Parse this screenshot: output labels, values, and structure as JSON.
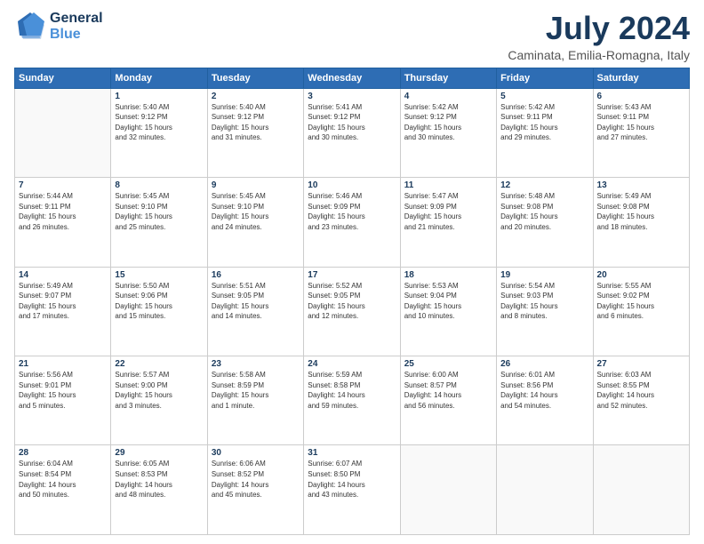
{
  "header": {
    "logo_general": "General",
    "logo_blue": "Blue",
    "title": "July 2024",
    "subtitle": "Caminata, Emilia-Romagna, Italy"
  },
  "days_of_week": [
    "Sunday",
    "Monday",
    "Tuesday",
    "Wednesday",
    "Thursday",
    "Friday",
    "Saturday"
  ],
  "weeks": [
    [
      {
        "day": "",
        "info": ""
      },
      {
        "day": "1",
        "info": "Sunrise: 5:40 AM\nSunset: 9:12 PM\nDaylight: 15 hours\nand 32 minutes."
      },
      {
        "day": "2",
        "info": "Sunrise: 5:40 AM\nSunset: 9:12 PM\nDaylight: 15 hours\nand 31 minutes."
      },
      {
        "day": "3",
        "info": "Sunrise: 5:41 AM\nSunset: 9:12 PM\nDaylight: 15 hours\nand 30 minutes."
      },
      {
        "day": "4",
        "info": "Sunrise: 5:42 AM\nSunset: 9:12 PM\nDaylight: 15 hours\nand 30 minutes."
      },
      {
        "day": "5",
        "info": "Sunrise: 5:42 AM\nSunset: 9:11 PM\nDaylight: 15 hours\nand 29 minutes."
      },
      {
        "day": "6",
        "info": "Sunrise: 5:43 AM\nSunset: 9:11 PM\nDaylight: 15 hours\nand 27 minutes."
      }
    ],
    [
      {
        "day": "7",
        "info": "Sunrise: 5:44 AM\nSunset: 9:11 PM\nDaylight: 15 hours\nand 26 minutes."
      },
      {
        "day": "8",
        "info": "Sunrise: 5:45 AM\nSunset: 9:10 PM\nDaylight: 15 hours\nand 25 minutes."
      },
      {
        "day": "9",
        "info": "Sunrise: 5:45 AM\nSunset: 9:10 PM\nDaylight: 15 hours\nand 24 minutes."
      },
      {
        "day": "10",
        "info": "Sunrise: 5:46 AM\nSunset: 9:09 PM\nDaylight: 15 hours\nand 23 minutes."
      },
      {
        "day": "11",
        "info": "Sunrise: 5:47 AM\nSunset: 9:09 PM\nDaylight: 15 hours\nand 21 minutes."
      },
      {
        "day": "12",
        "info": "Sunrise: 5:48 AM\nSunset: 9:08 PM\nDaylight: 15 hours\nand 20 minutes."
      },
      {
        "day": "13",
        "info": "Sunrise: 5:49 AM\nSunset: 9:08 PM\nDaylight: 15 hours\nand 18 minutes."
      }
    ],
    [
      {
        "day": "14",
        "info": "Sunrise: 5:49 AM\nSunset: 9:07 PM\nDaylight: 15 hours\nand 17 minutes."
      },
      {
        "day": "15",
        "info": "Sunrise: 5:50 AM\nSunset: 9:06 PM\nDaylight: 15 hours\nand 15 minutes."
      },
      {
        "day": "16",
        "info": "Sunrise: 5:51 AM\nSunset: 9:05 PM\nDaylight: 15 hours\nand 14 minutes."
      },
      {
        "day": "17",
        "info": "Sunrise: 5:52 AM\nSunset: 9:05 PM\nDaylight: 15 hours\nand 12 minutes."
      },
      {
        "day": "18",
        "info": "Sunrise: 5:53 AM\nSunset: 9:04 PM\nDaylight: 15 hours\nand 10 minutes."
      },
      {
        "day": "19",
        "info": "Sunrise: 5:54 AM\nSunset: 9:03 PM\nDaylight: 15 hours\nand 8 minutes."
      },
      {
        "day": "20",
        "info": "Sunrise: 5:55 AM\nSunset: 9:02 PM\nDaylight: 15 hours\nand 6 minutes."
      }
    ],
    [
      {
        "day": "21",
        "info": "Sunrise: 5:56 AM\nSunset: 9:01 PM\nDaylight: 15 hours\nand 5 minutes."
      },
      {
        "day": "22",
        "info": "Sunrise: 5:57 AM\nSunset: 9:00 PM\nDaylight: 15 hours\nand 3 minutes."
      },
      {
        "day": "23",
        "info": "Sunrise: 5:58 AM\nSunset: 8:59 PM\nDaylight: 15 hours\nand 1 minute."
      },
      {
        "day": "24",
        "info": "Sunrise: 5:59 AM\nSunset: 8:58 PM\nDaylight: 14 hours\nand 59 minutes."
      },
      {
        "day": "25",
        "info": "Sunrise: 6:00 AM\nSunset: 8:57 PM\nDaylight: 14 hours\nand 56 minutes."
      },
      {
        "day": "26",
        "info": "Sunrise: 6:01 AM\nSunset: 8:56 PM\nDaylight: 14 hours\nand 54 minutes."
      },
      {
        "day": "27",
        "info": "Sunrise: 6:03 AM\nSunset: 8:55 PM\nDaylight: 14 hours\nand 52 minutes."
      }
    ],
    [
      {
        "day": "28",
        "info": "Sunrise: 6:04 AM\nSunset: 8:54 PM\nDaylight: 14 hours\nand 50 minutes."
      },
      {
        "day": "29",
        "info": "Sunrise: 6:05 AM\nSunset: 8:53 PM\nDaylight: 14 hours\nand 48 minutes."
      },
      {
        "day": "30",
        "info": "Sunrise: 6:06 AM\nSunset: 8:52 PM\nDaylight: 14 hours\nand 45 minutes."
      },
      {
        "day": "31",
        "info": "Sunrise: 6:07 AM\nSunset: 8:50 PM\nDaylight: 14 hours\nand 43 minutes."
      },
      {
        "day": "",
        "info": ""
      },
      {
        "day": "",
        "info": ""
      },
      {
        "day": "",
        "info": ""
      }
    ]
  ]
}
